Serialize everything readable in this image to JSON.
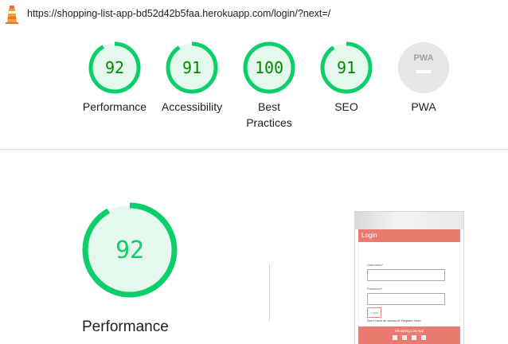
{
  "url": "https://shopping-list-app-bd52d42b5faa.herokuapp.com/login/?next=/",
  "colors": {
    "pass": "#0cce6b",
    "pass_bg": "#e5f8ed",
    "pass_text": "#008800",
    "na": "#9e9e9e",
    "na_bg": "#e6e6e6"
  },
  "scores": [
    {
      "value": "92",
      "label": "Performance"
    },
    {
      "value": "91",
      "label": "Accessibility"
    },
    {
      "value": "100",
      "label": "Best Practices"
    },
    {
      "value": "91",
      "label": "SEO"
    },
    {
      "value": "PWA",
      "label": "PWA"
    }
  ],
  "main": {
    "score": "92",
    "label": "Performance"
  },
  "screenshot": {
    "header": "Login",
    "username_label": "Username*",
    "password_label": "Password*",
    "login_button": "Login",
    "register_text": "Don't have an account? Register Here",
    "footer": "Shopping List App"
  }
}
